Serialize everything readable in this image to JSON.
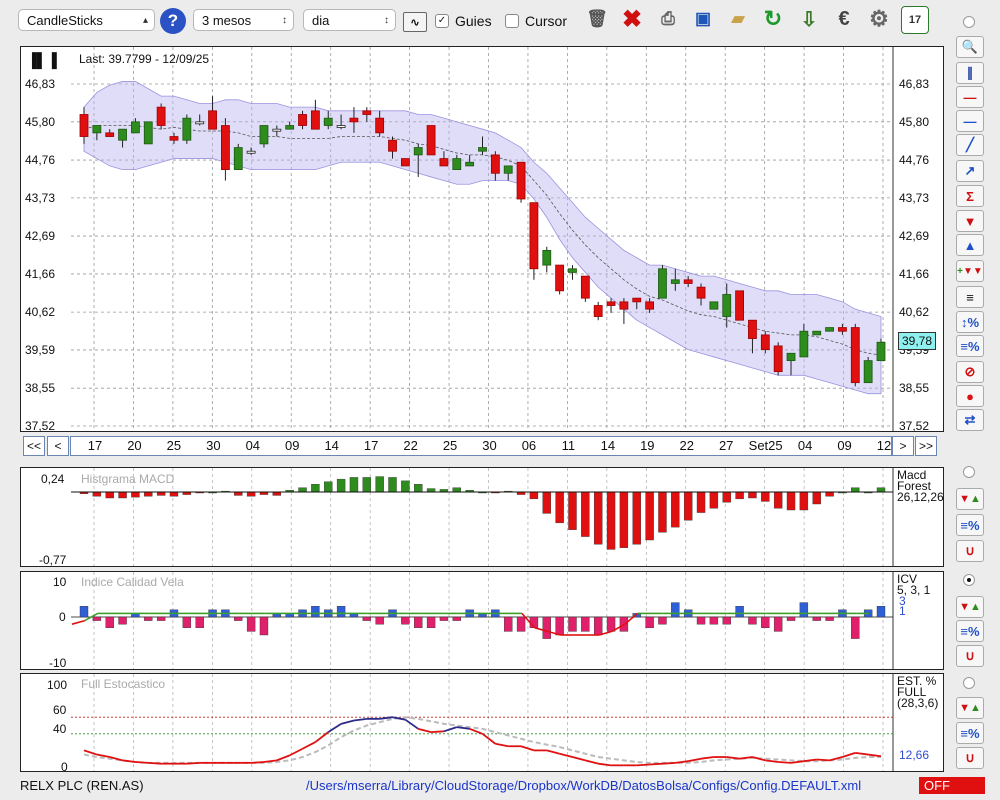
{
  "toolbar": {
    "chart_type": "CandleSticks",
    "period": "3 mesos",
    "interval": "dia",
    "guides_label": "Guies",
    "guides_checked": true,
    "cursor_label": "Cursor",
    "cursor_checked": false,
    "help_icon": "?",
    "calendar_day": "17"
  },
  "main_chart": {
    "last_label": "Last: 39.7799 - 12/09/25",
    "current_price_label": "39,78",
    "y_ticks": [
      "46,83",
      "45,80",
      "44,76",
      "43,73",
      "42,69",
      "41,66",
      "40,62",
      "39,59",
      "38,55",
      "37,52"
    ],
    "x_labels": [
      "17",
      "20",
      "25",
      "30",
      "04",
      "09",
      "14",
      "17",
      "22",
      "25",
      "30",
      "06",
      "11",
      "14",
      "19",
      "22",
      "27",
      "Set25",
      "04",
      "09",
      "12"
    ],
    "nav": {
      "first": "<<",
      "prev": "<",
      "next": ">",
      "last": ">>"
    }
  },
  "macd_panel": {
    "title": "Histgrama MACD",
    "label_line1": "Macd",
    "label_line2": "Forest",
    "params": "26,12,26",
    "y_top": "0,24",
    "y_bottom": "-0,77"
  },
  "icv_panel": {
    "title": "Indice Calidad Vela",
    "label": "ICV",
    "params": "5, 3, 1",
    "value1": "3",
    "value2": "1",
    "y_top": "10",
    "y_mid": "0",
    "y_bottom": "-10"
  },
  "stoch_panel": {
    "title": "Full Estocastico",
    "label_line1": "EST. %",
    "label_line2": "FULL",
    "params": "(28,3,6)",
    "value": "12,66",
    "y_ticks": [
      "100",
      "60",
      "40",
      "0"
    ]
  },
  "status_bar": {
    "symbol": "RELX PLC (REN.AS)",
    "config_path": "/Users/mserra/Library/CloudStorage/Dropbox/WorkDB/DatosBolsa/Configs/Config.DEFAULT.xml",
    "state": "OFF"
  },
  "colors": {
    "up_candle": "#2e8b1e",
    "down_candle": "#e01010",
    "band_fill": "#b9b3f0",
    "hist_pos": "#2e8b1e",
    "hist_neg": "#e01010",
    "icv_pos": "#2f5fd6",
    "icv_neg": "#e0206a",
    "stoch_k": "#e01010",
    "stoch_d": "#bbbbbb",
    "stoch_over": "#2a2a8a",
    "status_off_bg": "#e01010"
  },
  "chart_data": [
    {
      "type": "candlestick",
      "title": "",
      "ylim": [
        37.52,
        47.3
      ],
      "y_ticks": [
        46.83,
        45.8,
        44.76,
        43.73,
        42.69,
        41.66,
        40.62,
        39.59,
        38.55,
        37.52
      ],
      "ohlc": [
        [
          46.0,
          46.2,
          45.2,
          45.4
        ],
        [
          45.5,
          45.7,
          45.3,
          45.7
        ],
        [
          45.5,
          45.6,
          45.4,
          45.4
        ],
        [
          45.3,
          45.6,
          45.1,
          45.6
        ],
        [
          45.5,
          45.9,
          45.5,
          45.8
        ],
        [
          45.2,
          45.8,
          45.2,
          45.8
        ],
        [
          46.2,
          46.3,
          45.6,
          45.7
        ],
        [
          45.4,
          45.5,
          45.2,
          45.3
        ],
        [
          45.3,
          46.0,
          45.2,
          45.9
        ],
        [
          45.8,
          46.0,
          45.7,
          45.8
        ],
        [
          46.1,
          46.5,
          45.6,
          45.6
        ],
        [
          45.7,
          45.9,
          44.2,
          44.5
        ],
        [
          44.5,
          45.2,
          44.5,
          45.1
        ],
        [
          45.0,
          45.1,
          44.9,
          45.0
        ],
        [
          45.2,
          45.7,
          45.1,
          45.7
        ],
        [
          45.6,
          45.7,
          45.4,
          45.6
        ],
        [
          45.6,
          45.8,
          45.6,
          45.7
        ],
        [
          46.0,
          46.1,
          45.6,
          45.7
        ],
        [
          46.1,
          46.4,
          45.7,
          45.6
        ],
        [
          45.7,
          46.1,
          45.6,
          45.9
        ],
        [
          45.7,
          46.0,
          45.6,
          45.7
        ],
        [
          45.9,
          46.2,
          45.5,
          45.8
        ],
        [
          46.1,
          46.2,
          45.8,
          46.0
        ],
        [
          45.9,
          46.1,
          45.4,
          45.5
        ],
        [
          45.3,
          45.4,
          44.8,
          45.0
        ],
        [
          44.8,
          44.8,
          44.6,
          44.6
        ],
        [
          44.9,
          45.2,
          44.3,
          45.1
        ],
        [
          45.7,
          45.7,
          44.9,
          44.9
        ],
        [
          44.8,
          45.0,
          44.6,
          44.6
        ],
        [
          44.5,
          44.9,
          44.5,
          44.8
        ],
        [
          44.6,
          44.9,
          44.6,
          44.7
        ],
        [
          45.0,
          45.4,
          44.9,
          45.1
        ],
        [
          44.9,
          45.0,
          44.2,
          44.4
        ],
        [
          44.4,
          44.6,
          44.2,
          44.6
        ],
        [
          44.7,
          44.7,
          43.6,
          43.7
        ],
        [
          43.6,
          43.6,
          41.5,
          41.8
        ],
        [
          41.9,
          42.4,
          41.7,
          42.3
        ],
        [
          41.9,
          41.9,
          41.1,
          41.2
        ],
        [
          41.7,
          41.9,
          41.5,
          41.8
        ],
        [
          41.6,
          41.6,
          40.9,
          41.0
        ],
        [
          40.8,
          40.9,
          40.4,
          40.5
        ],
        [
          40.9,
          41.0,
          40.6,
          40.8
        ],
        [
          40.9,
          41.0,
          40.3,
          40.7
        ],
        [
          41.0,
          41.0,
          40.7,
          40.9
        ],
        [
          40.9,
          41.0,
          40.6,
          40.7
        ],
        [
          41.0,
          41.9,
          41.0,
          41.8
        ],
        [
          41.4,
          41.8,
          41.2,
          41.5
        ],
        [
          41.5,
          41.6,
          41.3,
          41.4
        ],
        [
          41.3,
          41.4,
          40.8,
          41.0
        ],
        [
          40.7,
          40.9,
          40.8,
          40.9
        ],
        [
          40.5,
          41.4,
          40.2,
          41.1
        ],
        [
          41.2,
          41.2,
          40.4,
          40.4
        ],
        [
          40.4,
          40.4,
          39.5,
          39.9
        ],
        [
          40.0,
          40.1,
          39.5,
          39.6
        ],
        [
          39.7,
          39.8,
          38.9,
          39.0
        ],
        [
          39.3,
          39.5,
          38.9,
          39.5
        ],
        [
          39.4,
          40.3,
          39.4,
          40.1
        ],
        [
          40.0,
          40.1,
          40.0,
          40.1
        ],
        [
          40.1,
          40.2,
          40.1,
          40.2
        ],
        [
          40.2,
          40.3,
          40.0,
          40.1
        ],
        [
          40.2,
          40.3,
          38.6,
          38.7
        ],
        [
          38.7,
          39.4,
          38.7,
          39.3
        ],
        [
          39.3,
          39.9,
          39.3,
          39.8
        ]
      ],
      "bollinger_upper": [
        46.2,
        46.6,
        46.8,
        46.9,
        46.9,
        46.7,
        46.5,
        46.5,
        46.4,
        46.3,
        46.3,
        46.4,
        46.4,
        46.3,
        46.3,
        46.3,
        46.2,
        46.2,
        46.2,
        46.1,
        46.1,
        46.1,
        46.1,
        46.1,
        46.1,
        46.1,
        46.0,
        46.0,
        45.9,
        45.8,
        45.7,
        45.6,
        45.5,
        45.3,
        45.1,
        44.7,
        44.4,
        44.0,
        43.6,
        43.2,
        42.9,
        42.6,
        42.3,
        42.1,
        41.9,
        41.9,
        41.8,
        41.7,
        41.6,
        41.6,
        41.5,
        41.4,
        41.3,
        41.2,
        41.2,
        41.1,
        41.1,
        41.1,
        41.0,
        40.9,
        40.7,
        40.6,
        40.5
      ],
      "bollinger_lower": [
        45.0,
        44.8,
        44.6,
        44.5,
        44.5,
        44.6,
        44.7,
        44.8,
        44.8,
        44.8,
        44.8,
        44.7,
        44.6,
        44.5,
        44.5,
        44.5,
        44.5,
        44.5,
        44.5,
        44.6,
        44.7,
        44.7,
        44.7,
        44.7,
        44.6,
        44.5,
        44.4,
        44.3,
        44.2,
        44.1,
        44.1,
        44.2,
        44.2,
        44.2,
        44.1,
        43.7,
        43.2,
        42.6,
        42.1,
        41.7,
        41.3,
        41.0,
        40.7,
        40.4,
        40.2,
        40.0,
        39.8,
        39.6,
        39.5,
        39.4,
        39.3,
        39.2,
        39.1,
        39.0,
        38.9,
        38.9,
        38.9,
        38.8,
        38.7,
        38.6,
        38.5,
        38.4,
        38.4
      ],
      "bollinger_middle": [
        45.6,
        45.7,
        45.7,
        45.7,
        45.7,
        45.65,
        45.6,
        45.65,
        45.6,
        45.55,
        45.55,
        45.55,
        45.5,
        45.4,
        45.4,
        45.4,
        45.35,
        45.35,
        45.35,
        45.35,
        45.4,
        45.4,
        45.4,
        45.4,
        45.35,
        45.3,
        45.2,
        45.15,
        45.05,
        44.95,
        44.9,
        44.9,
        44.85,
        44.75,
        44.6,
        44.2,
        43.8,
        43.3,
        42.85,
        42.45,
        42.1,
        41.8,
        41.5,
        41.25,
        41.05,
        40.95,
        40.8,
        40.65,
        40.55,
        40.5,
        40.4,
        40.3,
        40.2,
        40.1,
        40.05,
        40.0,
        40.0,
        39.95,
        39.85,
        39.75,
        39.6,
        39.5,
        39.45
      ]
    },
    {
      "type": "bar",
      "title": "Histgrama MACD",
      "ylim": [
        -0.77,
        0.24
      ],
      "values": [
        -0.02,
        -0.05,
        -0.07,
        -0.07,
        -0.06,
        -0.05,
        -0.04,
        -0.05,
        -0.03,
        -0.01,
        0.0,
        0.01,
        -0.04,
        -0.05,
        -0.03,
        -0.04,
        0.02,
        0.05,
        0.09,
        0.12,
        0.15,
        0.17,
        0.17,
        0.18,
        0.17,
        0.13,
        0.09,
        0.04,
        0.03,
        0.05,
        0.02,
        0.0,
        -0.01,
        0.01,
        -0.03,
        -0.08,
        -0.25,
        -0.36,
        -0.44,
        -0.52,
        -0.61,
        -0.67,
        -0.65,
        -0.61,
        -0.56,
        -0.47,
        -0.41,
        -0.33,
        -0.24,
        -0.19,
        -0.12,
        -0.08,
        -0.07,
        -0.11,
        -0.19,
        -0.21,
        -0.21,
        -0.14,
        -0.05,
        0.0,
        0.05,
        0.0,
        0.05
      ]
    },
    {
      "type": "bar",
      "title": "Indice Calidad Vela",
      "ylim": [
        -10,
        10
      ],
      "values": [
        3,
        -1,
        -3,
        -2,
        1,
        -1,
        -1,
        2,
        -3,
        -3,
        2,
        2,
        -1,
        -4,
        -5,
        1,
        1,
        2,
        3,
        2,
        3,
        1,
        -1,
        -2,
        2,
        -2,
        -3,
        -3,
        -1,
        -1,
        2,
        1,
        2,
        -4,
        -4,
        -3,
        -6,
        -5,
        -4,
        -4,
        -5,
        -4,
        -4,
        1,
        -3,
        -2,
        4,
        2,
        -2,
        -2,
        -2,
        3,
        -2,
        -3,
        -4,
        -1,
        4,
        -1,
        -1,
        2,
        -6,
        2,
        3
      ],
      "signal": [
        -2,
        -1,
        1,
        1,
        1,
        1,
        1,
        1,
        1,
        1,
        1,
        1,
        1,
        1,
        1,
        1,
        1,
        1,
        1,
        1,
        1,
        1,
        1,
        1,
        1,
        1,
        1,
        1,
        1,
        1,
        1,
        1,
        1,
        1,
        1,
        1,
        -3,
        -4,
        -5,
        -5,
        -5,
        -5,
        -4,
        -2,
        1,
        1,
        1,
        1,
        1,
        1,
        1,
        1,
        1,
        1,
        1,
        1,
        1,
        1,
        1,
        1,
        1,
        1,
        1
      ]
    },
    {
      "type": "line",
      "title": "Full Estocastico",
      "ylim": [
        0,
        100
      ],
      "y_ticks": [
        100,
        60,
        40,
        0
      ],
      "series": [
        {
          "values": [
            20,
            15,
            12,
            8,
            6,
            5,
            4,
            4,
            4,
            5,
            5,
            5,
            5,
            5,
            6,
            8,
            14,
            22,
            30,
            42,
            52,
            56,
            58,
            58,
            60,
            57,
            46,
            42,
            43,
            48,
            46,
            40,
            28,
            25,
            25,
            20,
            20,
            16,
            12,
            8,
            4,
            2,
            2,
            2,
            3,
            4,
            5,
            7,
            10,
            12,
            12,
            10,
            12,
            8,
            6,
            5,
            7,
            9,
            8,
            12,
            17,
            15,
            13
          ]
        },
        {
          "values": [
            15,
            12,
            10,
            8,
            6,
            5,
            5,
            5,
            5,
            5,
            5,
            5,
            5,
            5,
            5,
            6,
            8,
            12,
            18,
            26,
            36,
            44,
            50,
            54,
            58,
            60,
            58,
            55,
            52,
            50,
            48,
            46,
            42,
            38,
            34,
            30,
            27,
            24,
            20,
            16,
            12,
            10,
            8,
            6,
            5,
            5,
            5,
            5,
            6,
            8,
            9,
            10,
            11,
            10,
            9,
            8,
            7,
            7,
            8,
            9,
            11,
            12,
            12
          ]
        }
      ]
    }
  ]
}
